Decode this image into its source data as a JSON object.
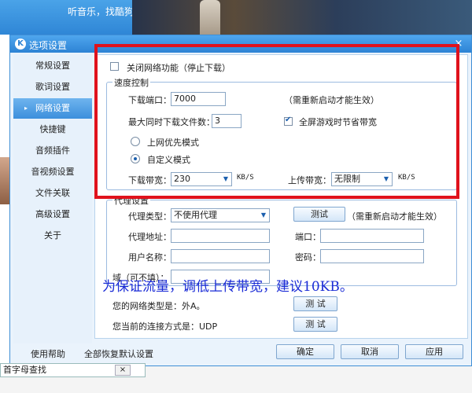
{
  "top": {
    "slogan": "听音乐，找酷狗"
  },
  "dialog": {
    "title": "选项设置",
    "close": "×"
  },
  "sidebar": {
    "items": [
      {
        "label": "常规设置"
      },
      {
        "label": "歌词设置"
      },
      {
        "label": "网络设置"
      },
      {
        "label": "快捷键"
      },
      {
        "label": "音频插件"
      },
      {
        "label": "音视频设置"
      },
      {
        "label": "文件关联"
      },
      {
        "label": "高级设置"
      },
      {
        "label": "关于"
      }
    ],
    "active_index": 2,
    "active_arrow": "▸"
  },
  "network": {
    "disable_label": "关闭网络功能（停止下载）",
    "speed_group": "速度控制",
    "port_label": "下载端口：",
    "port_value": "7000",
    "restart_note": "（需重新启动才能生效）",
    "max_files_label": "最大同时下载文件数：",
    "max_files_value": "3",
    "fullscreen_label": "全屏游戏时节省带宽",
    "mode_priority": "上网优先模式",
    "mode_custom": "自定义模式",
    "download_bw_label": "下载带宽：",
    "download_bw_value": "230",
    "unit": "KB/S",
    "upload_bw_label": "上传带宽：",
    "upload_bw_value": "无限制",
    "proxy_group": "代理设置",
    "proxy_type_label": "代理类型：",
    "proxy_type_value": "不使用代理",
    "test_btn": "测试",
    "test_btn_spaced": "测 试",
    "proxy_addr_label": "代理地址：",
    "port2_label": "端口：",
    "username_label": "用户名称：",
    "password_label": "密码：",
    "domain_label": "域（可不填）：",
    "net_type_label": "您的网络类型是：外A。",
    "conn_type_label": "您当前的连接方式是：UDP"
  },
  "overlay": "为保证流量，调低上传带宽，建议10KB。",
  "footer": {
    "help": "使用帮助",
    "restore": "全部恢复默认设置",
    "ok": "确定",
    "cancel": "取消",
    "apply": "应用"
  },
  "bottom": {
    "search_text": "首字母查找",
    "close": "×"
  },
  "colors": {
    "accent": "#2d83d4",
    "highlight": "#e0121c",
    "overlay_text": "#1a2bd6"
  }
}
